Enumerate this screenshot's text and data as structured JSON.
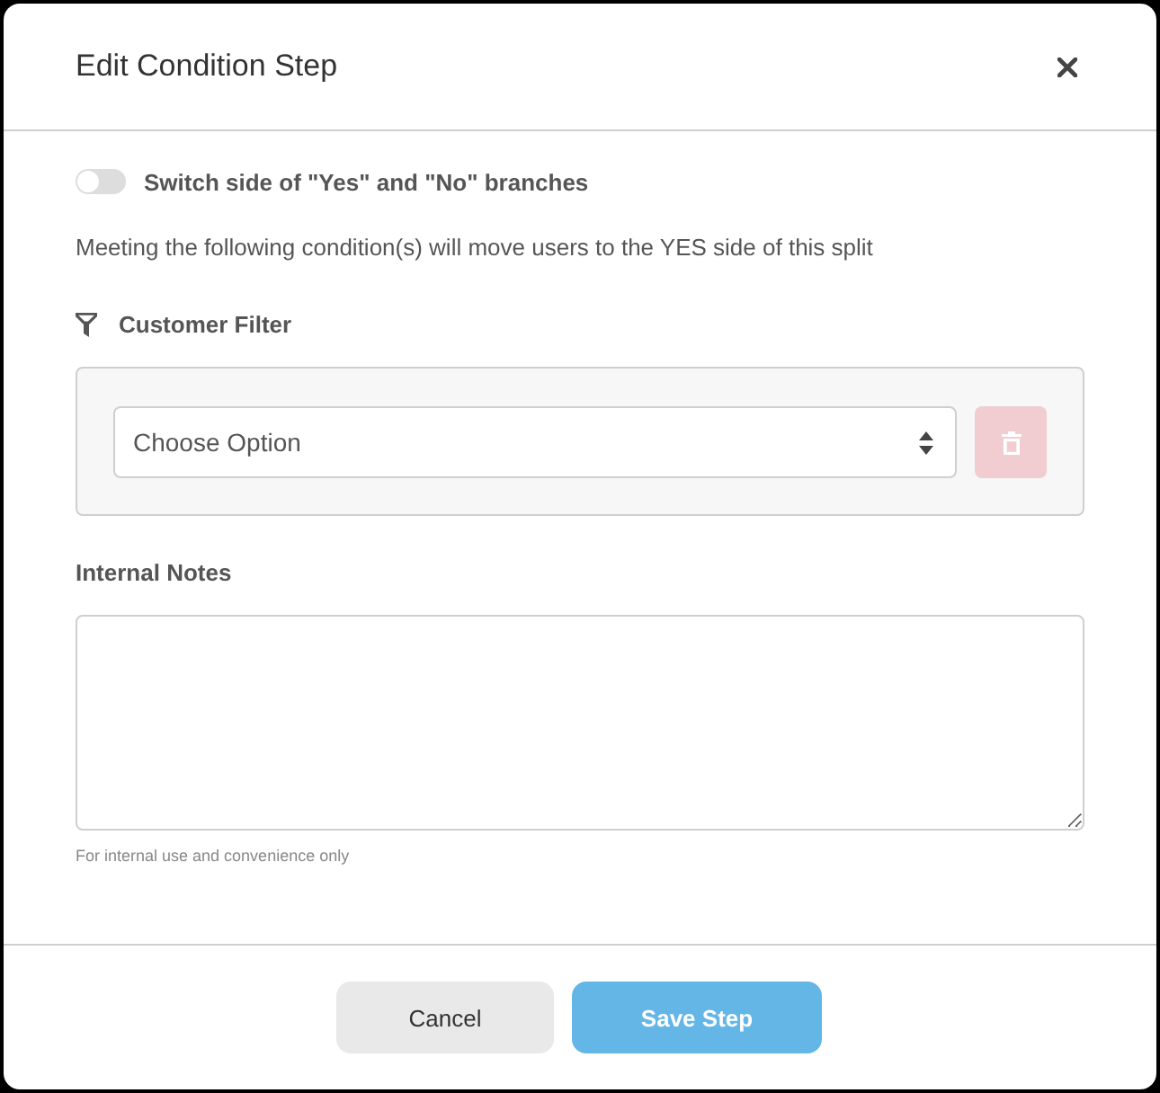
{
  "dialog": {
    "title": "Edit Condition Step"
  },
  "switch_branches": {
    "label": "Switch side of \"Yes\" and \"No\" branches",
    "on": false
  },
  "description": "Meeting the following condition(s) will move users to the YES side of this split",
  "filter": {
    "heading": "Customer Filter",
    "select": {
      "placeholder": "Choose Option"
    },
    "delete_button": {
      "disabled": true
    }
  },
  "notes": {
    "label": "Internal Notes",
    "hint": "For internal use and convenience only"
  },
  "buttons": [
    {
      "label": "Cancel",
      "kind": "secondary"
    },
    {
      "label": "Save Step",
      "kind": "primary"
    }
  ]
}
